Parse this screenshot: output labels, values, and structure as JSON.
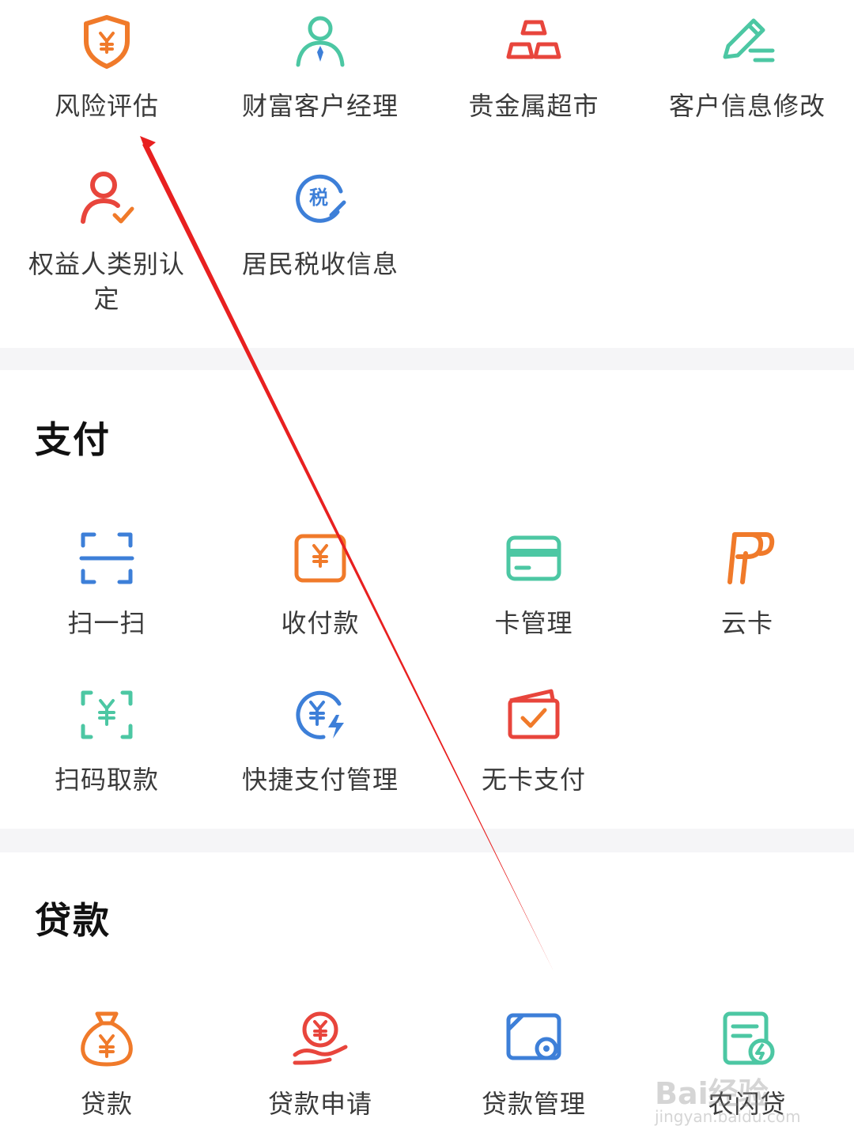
{
  "sections": [
    {
      "title": "",
      "items": [
        {
          "label": "风险评估",
          "icon": "shield-yuan-icon"
        },
        {
          "label": "财富客户经理",
          "icon": "manager-icon"
        },
        {
          "label": "贵金属超市",
          "icon": "gold-bars-icon"
        },
        {
          "label": "客户信息修改",
          "icon": "edit-pen-icon"
        },
        {
          "label": "权益人类别认定",
          "icon": "user-check-icon"
        },
        {
          "label": "居民税收信息",
          "icon": "tax-icon"
        }
      ]
    },
    {
      "title": "支付",
      "items": [
        {
          "label": "扫一扫",
          "icon": "scan-icon"
        },
        {
          "label": "收付款",
          "icon": "receive-pay-icon"
        },
        {
          "label": "卡管理",
          "icon": "card-icon"
        },
        {
          "label": "云卡",
          "icon": "cloud-card-icon"
        },
        {
          "label": "扫码取款",
          "icon": "scan-withdraw-icon"
        },
        {
          "label": "快捷支付管理",
          "icon": "quick-pay-icon"
        },
        {
          "label": "无卡支付",
          "icon": "cardless-pay-icon"
        }
      ]
    },
    {
      "title": "贷款",
      "items": [
        {
          "label": "贷款",
          "icon": "money-bag-icon"
        },
        {
          "label": "贷款申请",
          "icon": "loan-apply-icon"
        },
        {
          "label": "贷款管理",
          "icon": "loan-manage-icon"
        },
        {
          "label": "农闪贷",
          "icon": "farm-loan-icon"
        }
      ]
    }
  ],
  "watermark": {
    "brand": "Bai经验",
    "sub": "jingyan.baidu.com"
  },
  "colors": {
    "orange": "#f07a2a",
    "red": "#e8453c",
    "green": "#4cc7a3",
    "blue": "#3d7fd8",
    "arrow": "#e82020",
    "separator": "#f5f5f7"
  }
}
